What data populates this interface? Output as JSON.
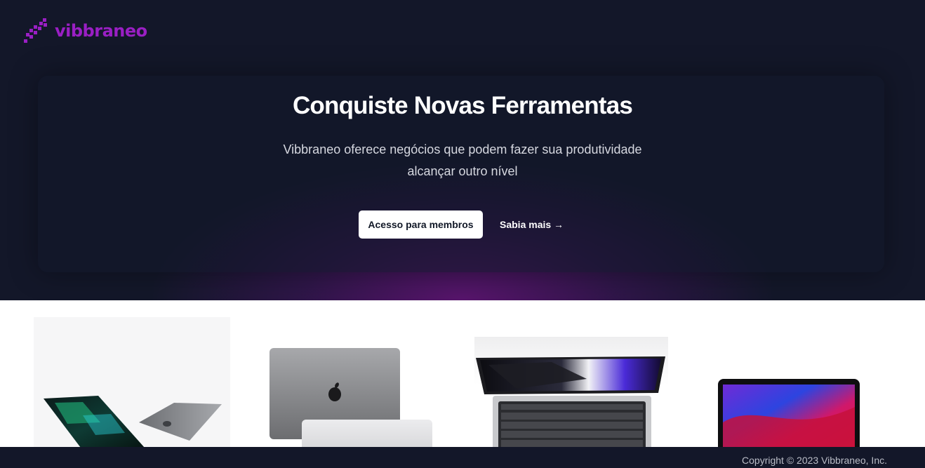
{
  "brand": {
    "name": "vibbraneo",
    "color": "#9a1fc4",
    "logo_icon": "pixel-arrow-icon"
  },
  "hero": {
    "title": "Conquiste Novas Ferramentas",
    "subtitle": "Vibbraneo oferece negócios que podem fazer sua produtividade alcançar outro nível",
    "primary_button": "Acesso para membros",
    "secondary_link": "Sabia mais →",
    "background": "#131729",
    "glow_color": "#6e1482"
  },
  "products": [
    {
      "image": "macbook-pro-open-angled"
    },
    {
      "image": "macbook-closed-space-gray"
    },
    {
      "image": "macbook-pro-top-view-keyboard"
    },
    {
      "image": "macbook-air-front-screen"
    }
  ],
  "footer": {
    "copyright": "Copyright © 2023 Vibbraneo, Inc."
  }
}
